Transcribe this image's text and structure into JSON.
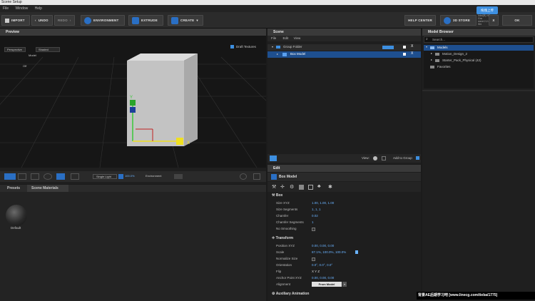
{
  "window": {
    "title": "Scene Setup"
  },
  "menu": {
    "items": [
      "File",
      "Window",
      "Help"
    ]
  },
  "toolbar": {
    "import": "IMPORT",
    "undo": "UNDO",
    "redo": "REDO",
    "environment": "ENVIRONMENT",
    "extrude": "EXTRUDE",
    "create": "CREATE",
    "help_center": "HELP CENTER",
    "store": "3D STORE",
    "x": "X",
    "ok": "OK",
    "version_line1": "Intel(R) HD Gra",
    "version_line2": "ment  2.2.0",
    "version_line3": "Shi",
    "badge": "拖拽上传"
  },
  "preview": {
    "tab": "Preview",
    "draft_textures": "Draft Textures",
    "camera": "Perspective",
    "shading": "Shaded",
    "model_label": "Model",
    "off_label": "Off",
    "light": "Single Light",
    "light_value": "100.0%",
    "environment": "Environment"
  },
  "presets": {
    "tab_presets": "Presets",
    "tab_materials": "Scene Materials",
    "material_label": "Default"
  },
  "scene": {
    "tab": "Scene",
    "menu": [
      "File",
      "Edit",
      "View"
    ],
    "group": "Group Folder",
    "model": "Box Model",
    "view_label": "View:",
    "add_group": "Add to Group"
  },
  "edit": {
    "tab": "Edit",
    "title": "Box Model",
    "box_section": "Box",
    "transform_section": "Transform",
    "aux_section": "Auxiliary Animation",
    "props": [
      {
        "label": "Size XYZ",
        "value": "1.00,  1.00,  1.00"
      },
      {
        "label": "Size Segments",
        "value": "1,   1,   1"
      },
      {
        "label": "Chamfer",
        "value": "0.02"
      },
      {
        "label": "Chamfer Segments",
        "value": "1"
      },
      {
        "label": "No Smoothing",
        "value": ""
      }
    ],
    "transform": [
      {
        "label": "Position XYZ",
        "value": "0.00,  0.00,  0.00"
      },
      {
        "label": "Scale",
        "value": "87.1%,  100.0%,  100.0%"
      },
      {
        "label": "Normalize Size",
        "value": ""
      },
      {
        "label": "Orientation",
        "value": "0.0°,  0.0°,  0.0°"
      },
      {
        "label": "Flip",
        "value": "X   Y   Z"
      },
      {
        "label": "Anchor Point XYZ",
        "value": "0.00,  0.00,  0.00"
      },
      {
        "label": "Alignment",
        "value": "From Model"
      }
    ]
  },
  "model_browser": {
    "tab": "Model Browser",
    "search_placeholder": "Search...",
    "models": "Models",
    "item1": "Motion_Design_2",
    "item2": "Starter_Pack_Physical (42)",
    "favorites": "Favorites"
  },
  "watermark": "背景AE后期学习吧   [www.linecg.com/tieba/1775]"
}
